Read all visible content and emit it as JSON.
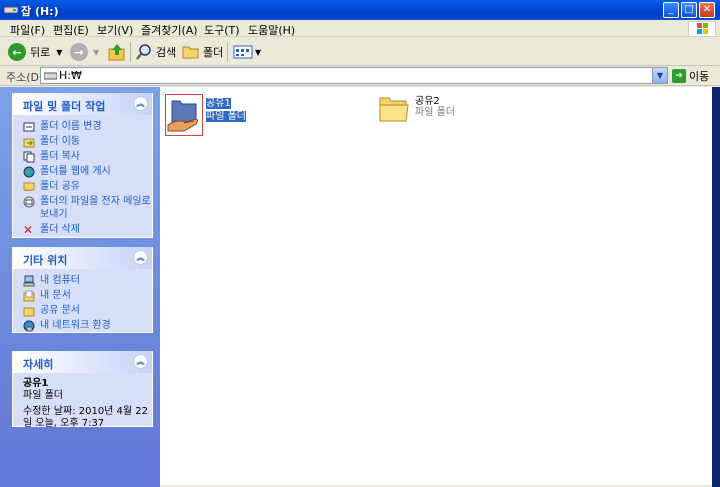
{
  "window": {
    "title": "잡 (H:)"
  },
  "menu": [
    "파일(F)",
    "편집(E)",
    "보기(V)",
    "즐겨찾기(A)",
    "도구(T)",
    "도움말(H)"
  ],
  "toolbar": {
    "back_label": "뒤로",
    "search_label": "검색",
    "folders_label": "폴더"
  },
  "address": {
    "label": "주소(D)",
    "value": "H:₩",
    "go_label": "이동"
  },
  "file_tasks": {
    "title": "파일 및 폴더 작업",
    "items": [
      "폴더 이름 변경",
      "폴더 이동",
      "폴더 복사",
      "폴더를 웹에 게시",
      "폴더 공유",
      "폴더의 파일을 전자 메일로 보내기",
      "폴더 삭제"
    ]
  },
  "other_places": {
    "title": "기타 위치",
    "items": [
      "내 컴퓨터",
      "내 문서",
      "공유 문서",
      "내 네트워크 환경"
    ]
  },
  "details": {
    "title": "자세히",
    "name": "공유1",
    "type": "파일 폴더",
    "modified": "수정한 날짜: 2010년 4월 22일 오늘, 오후 7:37"
  },
  "files": [
    {
      "name": "공유1",
      "type": "파일 폴더",
      "selected": true,
      "shared": true
    },
    {
      "name": "공유2",
      "type": "파일 폴더",
      "selected": false,
      "shared": false
    }
  ],
  "colors": {
    "title_blue": "#0048d8",
    "task_link": "#215dc6",
    "selection": "#316ac5",
    "pane_blue": "#6f8fdf"
  }
}
